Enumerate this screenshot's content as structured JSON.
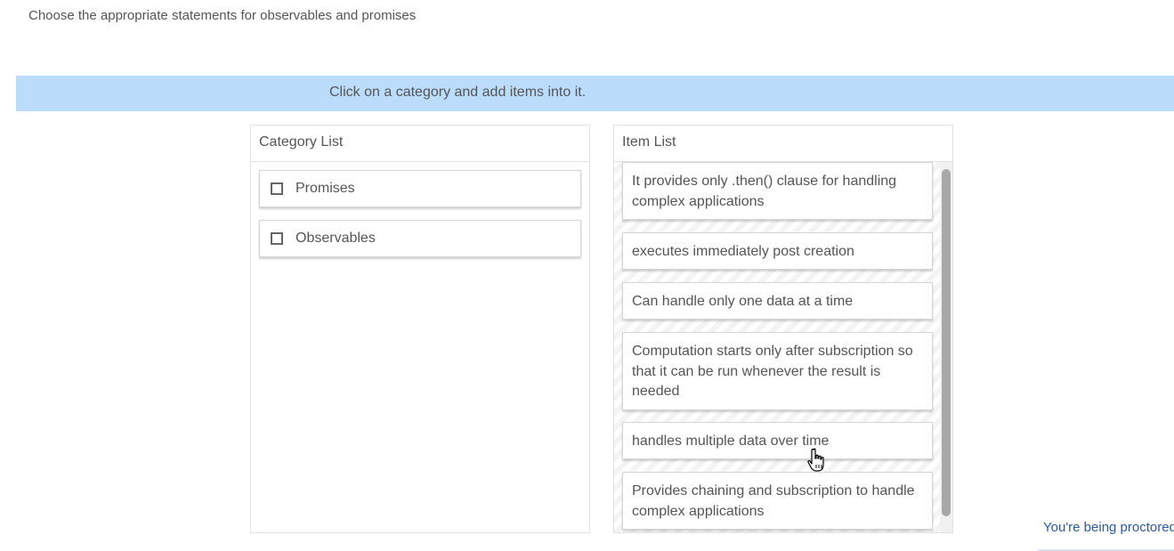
{
  "question": {
    "text": "Choose the appropriate statements for observables and promises"
  },
  "instruction": {
    "text": "Click on a category and add items into it."
  },
  "category_panel": {
    "header": "Category List",
    "items": [
      {
        "label": "Promises",
        "checked": false
      },
      {
        "label": "Observables",
        "checked": false
      }
    ]
  },
  "item_panel": {
    "header": "Item List",
    "items": [
      {
        "text": "It provides only .then() clause for handling complex applications"
      },
      {
        "text": "executes immediately post creation"
      },
      {
        "text": "Can handle only one data at a time"
      },
      {
        "text": "Computation starts only after subscription so that it can be run whenever the result is needed"
      },
      {
        "text": "handles multiple data over time"
      },
      {
        "text": "Provides chaining and subscription to handle complex applications"
      }
    ]
  },
  "proctor": {
    "text": "You're being proctored"
  },
  "colors": {
    "instruction_bar": "#bbdcfb",
    "text": "#555555",
    "proctor_text": "#2c5aa0"
  },
  "icons": {
    "cursor": "hand-pointer-icon",
    "checkbox": "checkbox-unchecked-icon"
  }
}
